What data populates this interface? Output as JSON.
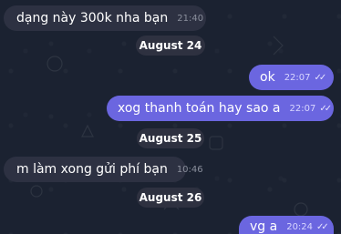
{
  "messages": [
    {
      "text": "dạng này 300k nha bạn",
      "time": "21:40",
      "direction": "in"
    },
    {
      "text": "ok",
      "time": "22:07",
      "direction": "out",
      "read": true
    },
    {
      "text": "xog thanh toán hay sao a",
      "time": "22:07",
      "direction": "out",
      "read": true
    },
    {
      "text": "m làm xong gửi phí bạn",
      "time": "10:46",
      "direction": "in"
    },
    {
      "text": "vg a",
      "time": "20:24",
      "direction": "out",
      "read": true
    }
  ],
  "dates": [
    "August 24",
    "August 25",
    "August 26"
  ],
  "icons": {
    "read_receipt": "double-check-icon"
  },
  "colors": {
    "background": "#1b2231",
    "incoming_bubble": "#2d3142",
    "outgoing_bubble": "#6b66e0",
    "date_pill": "#2e3140"
  }
}
